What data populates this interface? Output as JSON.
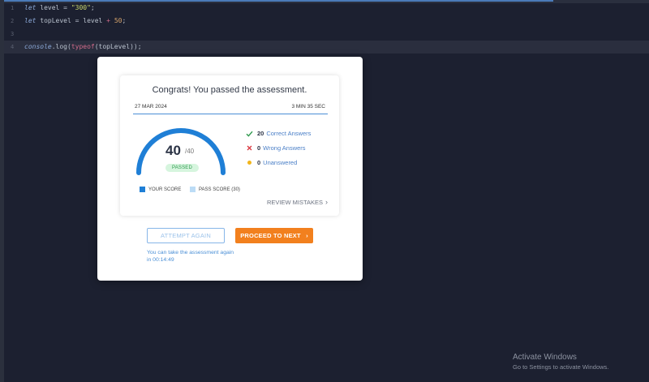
{
  "editor": {
    "lines": [
      {
        "num": "1",
        "tokens": [
          {
            "t": "let",
            "c": "kw"
          },
          {
            "t": " level = ",
            "c": ""
          },
          {
            "t": "\"300\"",
            "c": "str"
          },
          {
            "t": ";",
            "c": ""
          }
        ]
      },
      {
        "num": "2",
        "tokens": [
          {
            "t": "let",
            "c": "kw"
          },
          {
            "t": " topLevel = level ",
            "c": ""
          },
          {
            "t": "+",
            "c": "op"
          },
          {
            "t": " ",
            "c": ""
          },
          {
            "t": "50",
            "c": "num"
          },
          {
            "t": ";",
            "c": ""
          }
        ]
      },
      {
        "num": "3",
        "tokens": []
      },
      {
        "num": "4",
        "tokens": [
          {
            "t": "console",
            "c": "kw"
          },
          {
            "t": ".log(",
            "c": ""
          },
          {
            "t": "typeof",
            "c": "op"
          },
          {
            "t": "(topLevel));",
            "c": ""
          }
        ],
        "active": true
      }
    ]
  },
  "modal": {
    "title": "Congrats! You passed the assessment.",
    "date": "27 MAR 2024",
    "duration": "3 MIN 35 SEC",
    "score": {
      "value": "40",
      "total": "/40",
      "fraction": 1.0,
      "status": "PASSED"
    },
    "legend": {
      "your_score": "YOUR SCORE",
      "pass_score": "PASS SCORE (30)"
    },
    "stats": {
      "correct": {
        "count": "20",
        "label": "Correct Answers"
      },
      "wrong": {
        "count": "0",
        "label": "Wrong Answers"
      },
      "unanswered": {
        "count": "0",
        "label": "Unanswered"
      }
    },
    "review_label": "REVIEW MISTAKES",
    "attempt_label": "ATTEMPT AGAIN",
    "next_label": "PROCEED TO NEXT",
    "retake_note": "You can take the assessment again in 00:14:49"
  },
  "colors": {
    "accent": "#1f7fd6",
    "orange": "#f2801e",
    "passed_bg": "#d6f5de",
    "correct": "#2f9a4e",
    "wrong": "#d9363e",
    "unanswered": "#f2b51b"
  },
  "windows": {
    "title": "Activate Windows",
    "subtitle": "Go to Settings to activate Windows."
  }
}
